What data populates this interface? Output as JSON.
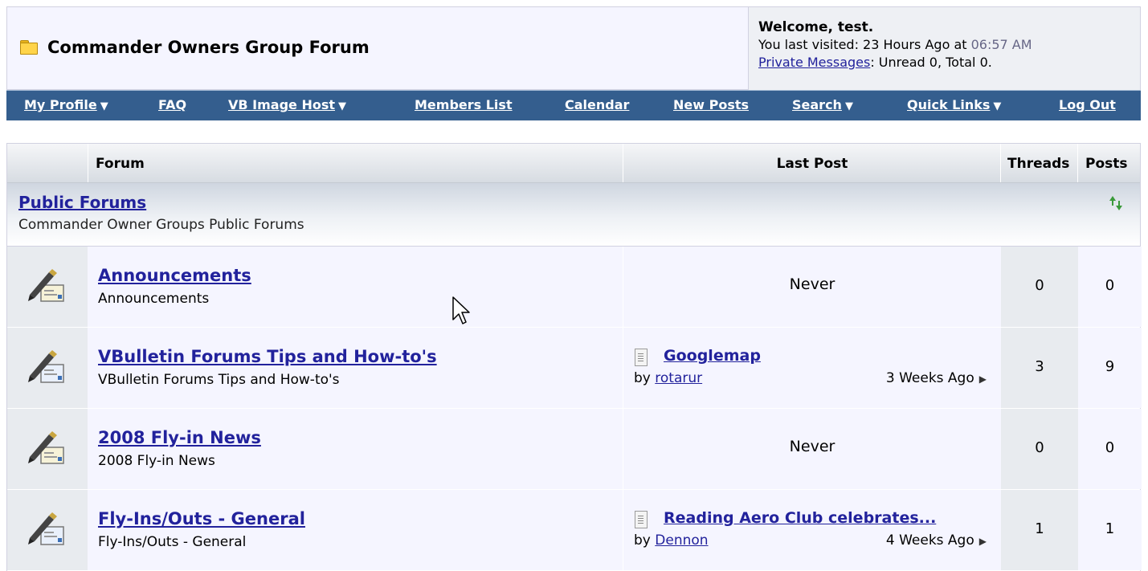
{
  "header": {
    "title": "Commander Owners Group Forum",
    "welcome_line": "Welcome, test.",
    "last_visited_prefix": "You last visited: 23 Hours Ago at ",
    "last_visited_time": "06:57 AM",
    "private_messages_link": "Private Messages",
    "private_messages_status": ": Unread 0, Total 0."
  },
  "navbar": {
    "items": [
      {
        "label": "My Profile",
        "dropdown": true
      },
      {
        "label": "FAQ",
        "dropdown": false
      },
      {
        "label": "VB Image Host",
        "dropdown": true
      },
      {
        "label": "Members List",
        "dropdown": false
      },
      {
        "label": "Calendar",
        "dropdown": false
      },
      {
        "label": "New Posts",
        "dropdown": false
      },
      {
        "label": "Search",
        "dropdown": true
      },
      {
        "label": "Quick Links",
        "dropdown": true
      },
      {
        "label": "Log Out",
        "dropdown": false
      }
    ],
    "caret": "▼"
  },
  "table": {
    "columns": {
      "forum": "Forum",
      "last_post": "Last Post",
      "threads": "Threads",
      "posts": "Posts"
    },
    "category": {
      "title": "Public Forums",
      "description": "Commander Owner Groups Public Forums"
    },
    "rows": [
      {
        "name": "Announcements",
        "description": "Announcements",
        "last_post": "Never",
        "threads": "0",
        "posts": "0"
      },
      {
        "name": "VBulletin Forums Tips and How-to's",
        "description": "VBulletin Forums Tips and How-to's",
        "last_post_title": "Googlemap",
        "last_post_by_prefix": "by ",
        "last_post_by": "rotarur",
        "last_post_when": "3 Weeks Ago",
        "threads": "3",
        "posts": "9"
      },
      {
        "name": "2008 Fly-in News",
        "description": "2008 Fly-in News",
        "last_post": "Never",
        "threads": "0",
        "posts": "0"
      },
      {
        "name": "Fly-Ins/Outs - General",
        "description": "Fly-Ins/Outs - General",
        "last_post_title": "Reading Aero Club celebrates...",
        "last_post_by_prefix": "by ",
        "last_post_by": "Dennon",
        "last_post_when": "4 Weeks Ago",
        "threads": "1",
        "posts": "1"
      }
    ]
  },
  "colors": {
    "navbar": "#345e8e",
    "link": "#22229c",
    "header_bg": "#f5f5ff"
  }
}
